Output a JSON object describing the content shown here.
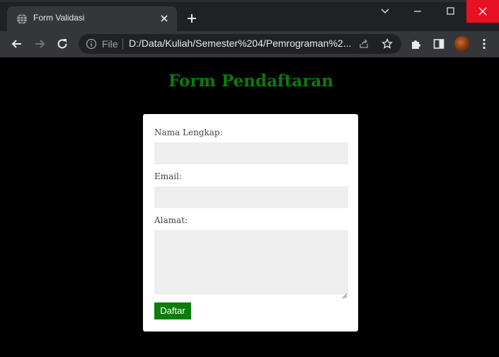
{
  "browser": {
    "tab": {
      "title": "Form Validasi",
      "favicon": "globe-icon"
    },
    "address": {
      "scheme_label": "File",
      "url": "D:/Data/Kuliah/Semester%204/Pemrograman%2..."
    }
  },
  "page": {
    "heading": "Form Pendaftaran",
    "form": {
      "fields": [
        {
          "label": "Nama Lengkap:",
          "value": "",
          "type": "text"
        },
        {
          "label": "Email:",
          "value": "",
          "type": "text"
        },
        {
          "label": "Alamat:",
          "value": "",
          "type": "textarea"
        }
      ],
      "submit_label": "Daftar"
    }
  },
  "colors": {
    "heading": "#0c7a0c",
    "submit_bg": "#0a7d0a",
    "field_bg": "#eeeeee",
    "close_button": "#e81123"
  }
}
